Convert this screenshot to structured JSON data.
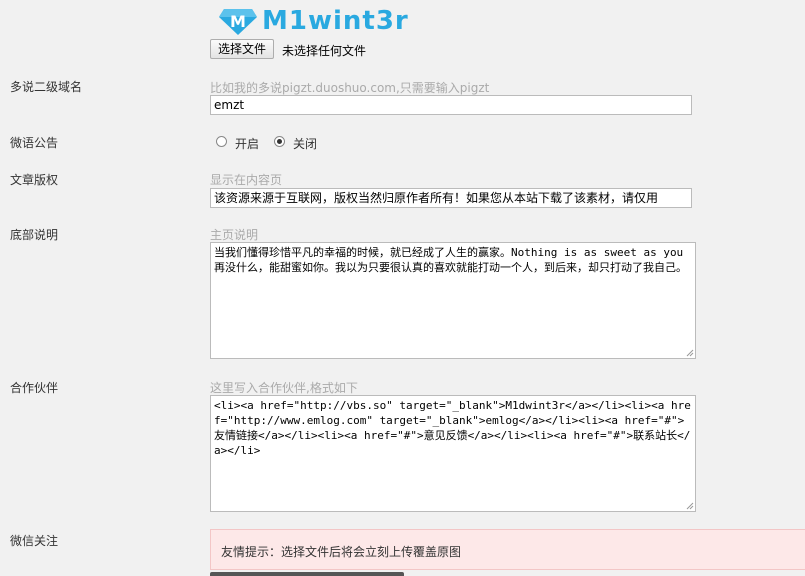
{
  "logo": {
    "text": "M1wint3r",
    "mark_letter": "M",
    "color": "#2aa9e0"
  },
  "upload": {
    "button_label": "选择文件",
    "status": "未选择任何文件"
  },
  "fields": {
    "duoshuo": {
      "label": "多说二级域名",
      "hint": "比如我的多说pigzt.duoshuo.com,只需要输入pigzt",
      "value": "emzt"
    },
    "weiyu": {
      "label": "微语公告",
      "options": [
        {
          "label": "开启",
          "checked": false
        },
        {
          "label": "关闭",
          "checked": true
        }
      ]
    },
    "copyright": {
      "label": "文章版权",
      "hint": "显示在内容页",
      "value": "该资源来源于互联网，版权当然归原作者所有！如果您从本站下载了该素材，请仅用"
    },
    "footer": {
      "label": "底部说明",
      "hint": "主页说明",
      "value": "当我们懂得珍惜平凡的幸福的时候，就已经成了人生的赢家。Nothing is as sweet as you 再没什么，能甜蜜如你。我以为只要很认真的喜欢就能打动一个人，到后来，却只打动了我自己。"
    },
    "partners": {
      "label": "合作伙伴",
      "hint": "这里写入合作伙伴,格式如下",
      "value": "<li><a href=\"http://vbs.so\" target=\"_blank\">M1dwint3r</a></li><li><a href=\"http://www.emlog.com\" target=\"_blank\">emlog</a></li><li><a href=\"#\">友情链接</a></li><li><a href=\"#\">意见反馈</a></li><li><a href=\"#\">联系站长</a></li>"
    },
    "wechat": {
      "label": "微信关注",
      "notice": "友情提示：选择文件后将会立刻上传覆盖原图"
    }
  }
}
